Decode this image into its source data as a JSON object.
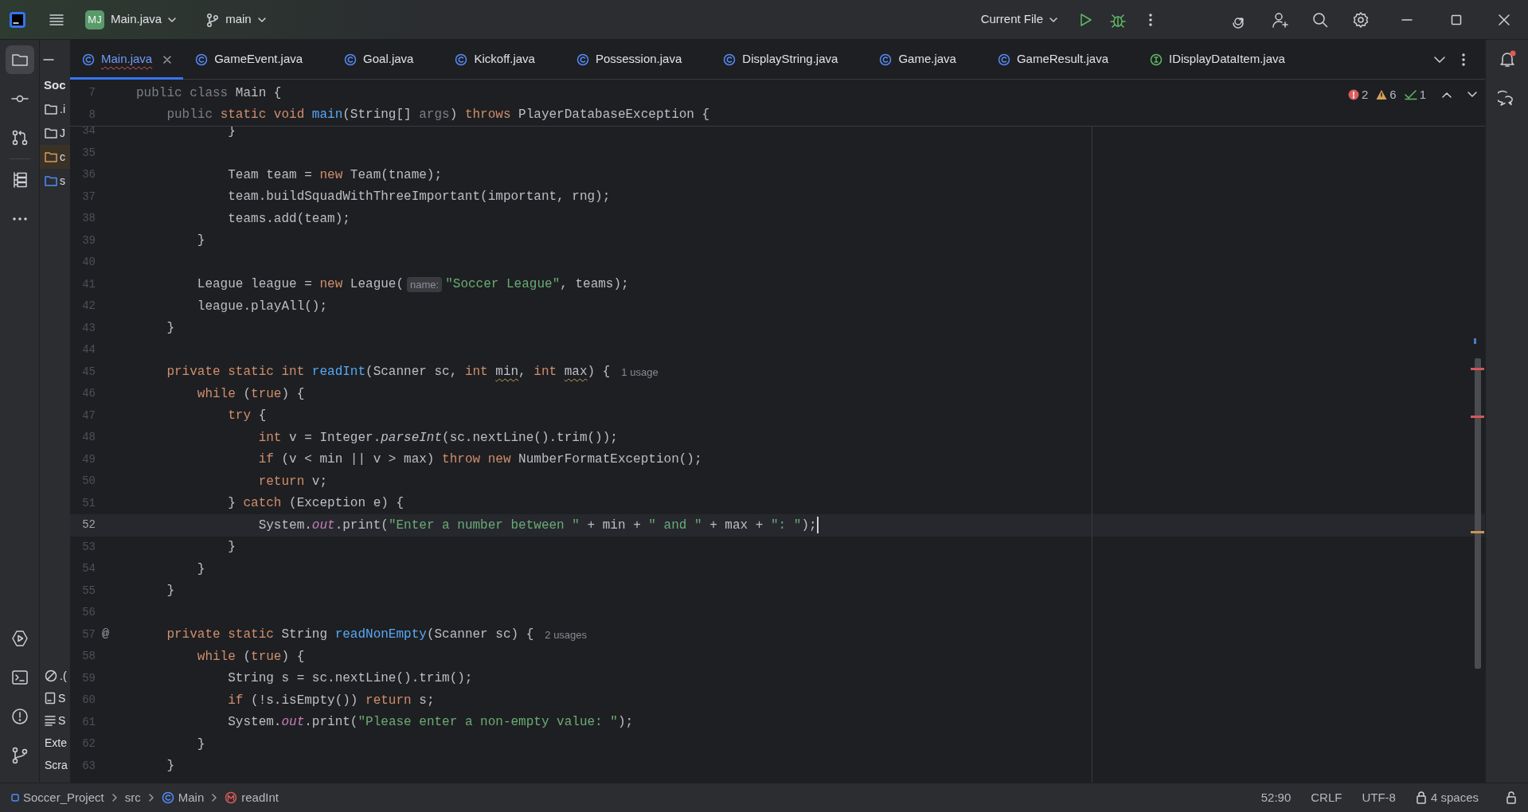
{
  "title_bar": {
    "project_badge": "MJ",
    "project": "Main.java",
    "branch": "main",
    "run_config": "Current File"
  },
  "left_tools": [
    {
      "kind": "project",
      "selected": true
    },
    {
      "kind": "commit",
      "selected": false
    },
    {
      "kind": "pull-requests",
      "selected": false
    },
    {
      "kind": "structure",
      "selected": false
    },
    {
      "kind": "more",
      "selected": false
    }
  ],
  "left_tools_bottom": [
    {
      "kind": "run",
      "selected": false
    },
    {
      "kind": "terminal",
      "selected": false
    },
    {
      "kind": "problems",
      "selected": false
    },
    {
      "kind": "git",
      "selected": false
    }
  ],
  "project_panel": {
    "top_items": [
      {
        "kind": "root",
        "label": "Soc",
        "selected": false
      },
      {
        "kind": "folder",
        "label": ".i",
        "selected": false
      },
      {
        "kind": "folder",
        "label": "J",
        "selected": false
      },
      {
        "kind": "excluded",
        "label": "c",
        "selected": true
      },
      {
        "kind": "source",
        "label": "s",
        "selected": false
      }
    ],
    "bottom_items": [
      {
        "kind": "ignored",
        "label": ".("
      },
      {
        "kind": "file",
        "label": "S"
      },
      {
        "kind": "text",
        "label": "S"
      },
      {
        "kind": "plain",
        "label": "Exte"
      },
      {
        "kind": "plain",
        "label": "Scra"
      }
    ]
  },
  "tabs": [
    {
      "label": "Main.java",
      "kind": "class",
      "selected": true,
      "error": true
    },
    {
      "label": "GameEvent.java",
      "kind": "class",
      "selected": false,
      "error": false
    },
    {
      "label": "Goal.java",
      "kind": "class",
      "selected": false,
      "error": false
    },
    {
      "label": "Kickoff.java",
      "kind": "class",
      "selected": false,
      "error": false
    },
    {
      "label": "Possession.java",
      "kind": "class",
      "selected": false,
      "error": false
    },
    {
      "label": "DisplayString.java",
      "kind": "class",
      "selected": false,
      "error": false
    },
    {
      "label": "Game.java",
      "kind": "class",
      "selected": false,
      "error": false
    },
    {
      "label": "GameResult.java",
      "kind": "class",
      "selected": false,
      "error": false
    },
    {
      "label": "IDisplayDataItem.java",
      "kind": "interface",
      "selected": false,
      "error": false
    }
  ],
  "inspections": {
    "errors": "2",
    "warnings": "6",
    "weak_warnings": "1"
  },
  "sticky_lines": [
    {
      "number": "7",
      "tokens": [
        {
          "kind": "dim",
          "text": "public class "
        },
        {
          "kind": "plain",
          "text": "Main {"
        }
      ]
    },
    {
      "number": "8",
      "tokens": [
        {
          "kind": "dim",
          "text": "    public "
        },
        {
          "kind": "keyword",
          "text": "static void "
        },
        {
          "kind": "method",
          "text": "main"
        },
        {
          "kind": "plain",
          "text": "(String[] "
        },
        {
          "kind": "unused",
          "text": "args"
        },
        {
          "kind": "plain",
          "text": ") "
        },
        {
          "kind": "keyword",
          "text": "throws "
        },
        {
          "kind": "plain",
          "text": "PlayerDatabaseException {"
        }
      ]
    }
  ],
  "lines": [
    {
      "number": "34",
      "current": false,
      "tokens": [
        {
          "kind": "plain",
          "text": "            }"
        }
      ]
    },
    {
      "number": "35",
      "current": false
    },
    {
      "number": "36",
      "current": false,
      "tokens": [
        {
          "kind": "plain",
          "text": "            Team team = "
        },
        {
          "kind": "keyword",
          "text": "new "
        },
        {
          "kind": "plain",
          "text": "Team(tname);"
        }
      ]
    },
    {
      "number": "37",
      "current": false,
      "tokens": [
        {
          "kind": "plain",
          "text": "            team.buildSquadWithThreeImportant(important, rng);"
        }
      ]
    },
    {
      "number": "38",
      "current": false,
      "tokens": [
        {
          "kind": "plain",
          "text": "            teams.add(team);"
        }
      ]
    },
    {
      "number": "39",
      "current": false,
      "tokens": [
        {
          "kind": "plain",
          "text": "        }"
        }
      ]
    },
    {
      "number": "40",
      "current": false
    },
    {
      "number": "41",
      "current": false,
      "tokens": [
        {
          "kind": "plain",
          "text": "        League league = "
        },
        {
          "kind": "keyword",
          "text": "new "
        },
        {
          "kind": "plain",
          "text": "League("
        },
        {
          "kind": "param-hint",
          "text": "name:"
        },
        {
          "kind": "string",
          "text": "\"Soccer League\""
        },
        {
          "kind": "plain",
          "text": ", teams);"
        }
      ]
    },
    {
      "number": "42",
      "current": false,
      "tokens": [
        {
          "kind": "plain",
          "text": "        league.playAll();"
        }
      ]
    },
    {
      "number": "43",
      "current": false,
      "tokens": [
        {
          "kind": "plain",
          "text": "    }"
        }
      ]
    },
    {
      "number": "44",
      "current": false
    },
    {
      "number": "45",
      "current": false,
      "tokens": [
        {
          "kind": "keyword",
          "text": "    private static int "
        },
        {
          "kind": "method",
          "text": "readInt"
        },
        {
          "kind": "plain",
          "text": "(Scanner sc, "
        },
        {
          "kind": "keyword",
          "text": "int "
        },
        {
          "kind": "warned",
          "text": "min"
        },
        {
          "kind": "plain",
          "text": ", "
        },
        {
          "kind": "keyword",
          "text": "int "
        },
        {
          "kind": "warned",
          "text": "max"
        },
        {
          "kind": "plain",
          "text": ") {"
        },
        {
          "kind": "usage-hint",
          "text": "1 usage"
        }
      ]
    },
    {
      "number": "46",
      "current": false,
      "tokens": [
        {
          "kind": "keyword",
          "text": "        while "
        },
        {
          "kind": "plain",
          "text": "("
        },
        {
          "kind": "keyword",
          "text": "true"
        },
        {
          "kind": "plain",
          "text": ") {"
        }
      ]
    },
    {
      "number": "47",
      "current": false,
      "tokens": [
        {
          "kind": "keyword",
          "text": "            try "
        },
        {
          "kind": "plain",
          "text": "{"
        }
      ]
    },
    {
      "number": "48",
      "current": false,
      "tokens": [
        {
          "kind": "keyword",
          "text": "                int "
        },
        {
          "kind": "plain",
          "text": "v = Integer."
        },
        {
          "kind": "static-call",
          "text": "parseInt"
        },
        {
          "kind": "plain",
          "text": "(sc.nextLine().trim());"
        }
      ]
    },
    {
      "number": "49",
      "current": false,
      "tokens": [
        {
          "kind": "keyword",
          "text": "                if "
        },
        {
          "kind": "plain",
          "text": "(v < min || v > max) "
        },
        {
          "kind": "keyword",
          "text": "throw new "
        },
        {
          "kind": "plain",
          "text": "NumberFormatException();"
        }
      ]
    },
    {
      "number": "50",
      "current": false,
      "tokens": [
        {
          "kind": "keyword",
          "text": "                return "
        },
        {
          "kind": "plain",
          "text": "v;"
        }
      ]
    },
    {
      "number": "51",
      "current": false,
      "tokens": [
        {
          "kind": "plain",
          "text": "            } "
        },
        {
          "kind": "keyword",
          "text": "catch "
        },
        {
          "kind": "plain",
          "text": "(Exception e) {"
        }
      ]
    },
    {
      "number": "52",
      "current": true,
      "tokens": [
        {
          "kind": "plain",
          "text": "                System."
        },
        {
          "kind": "static-field",
          "text": "out"
        },
        {
          "kind": "plain",
          "text": ".print("
        },
        {
          "kind": "string",
          "text": "\"Enter a number between \""
        },
        {
          "kind": "plain",
          "text": " + min + "
        },
        {
          "kind": "string",
          "text": "\" and \""
        },
        {
          "kind": "plain",
          "text": " + max + "
        },
        {
          "kind": "string",
          "text": "\": \""
        },
        {
          "kind": "plain",
          "text": ");"
        }
      ]
    },
    {
      "number": "53",
      "current": false,
      "tokens": [
        {
          "kind": "plain",
          "text": "            }"
        }
      ]
    },
    {
      "number": "54",
      "current": false,
      "tokens": [
        {
          "kind": "plain",
          "text": "        }"
        }
      ]
    },
    {
      "number": "55",
      "current": false,
      "tokens": [
        {
          "kind": "plain",
          "text": "    }"
        }
      ]
    },
    {
      "number": "56",
      "current": false
    },
    {
      "number": "57",
      "current": false,
      "gutter_mark": "@",
      "tokens": [
        {
          "kind": "keyword",
          "text": "    private static "
        },
        {
          "kind": "plain",
          "text": "String "
        },
        {
          "kind": "method",
          "text": "readNonEmpty"
        },
        {
          "kind": "plain",
          "text": "(Scanner sc) {"
        },
        {
          "kind": "usage-hint",
          "text": "2 usages"
        }
      ]
    },
    {
      "number": "58",
      "current": false,
      "tokens": [
        {
          "kind": "keyword",
          "text": "        while "
        },
        {
          "kind": "plain",
          "text": "("
        },
        {
          "kind": "keyword",
          "text": "true"
        },
        {
          "kind": "plain",
          "text": ") {"
        }
      ]
    },
    {
      "number": "59",
      "current": false,
      "tokens": [
        {
          "kind": "plain",
          "text": "            String s = sc.nextLine().trim();"
        }
      ]
    },
    {
      "number": "60",
      "current": false,
      "tokens": [
        {
          "kind": "keyword",
          "text": "            if "
        },
        {
          "kind": "plain",
          "text": "(!s.isEmpty()) "
        },
        {
          "kind": "keyword",
          "text": "return "
        },
        {
          "kind": "plain",
          "text": "s;"
        }
      ]
    },
    {
      "number": "61",
      "current": false,
      "tokens": [
        {
          "kind": "plain",
          "text": "            System."
        },
        {
          "kind": "static-field",
          "text": "out"
        },
        {
          "kind": "plain",
          "text": ".print("
        },
        {
          "kind": "string",
          "text": "\"Please enter a non-empty value: \""
        },
        {
          "kind": "plain",
          "text": ");"
        }
      ]
    },
    {
      "number": "62",
      "current": false,
      "tokens": [
        {
          "kind": "plain",
          "text": "        }"
        }
      ]
    },
    {
      "number": "63",
      "current": false,
      "tokens": [
        {
          "kind": "plain",
          "text": "    }"
        }
      ]
    }
  ],
  "status_bar": {
    "breadcrumbs": [
      {
        "kind": "project",
        "label": "Soccer_Project"
      },
      {
        "kind": "folder",
        "label": "src"
      },
      {
        "kind": "class",
        "label": "Main"
      },
      {
        "kind": "method",
        "label": "readInt"
      }
    ],
    "position": "52:90",
    "line_separator": "CRLF",
    "encoding": "UTF-8",
    "indent": "4 spaces"
  }
}
